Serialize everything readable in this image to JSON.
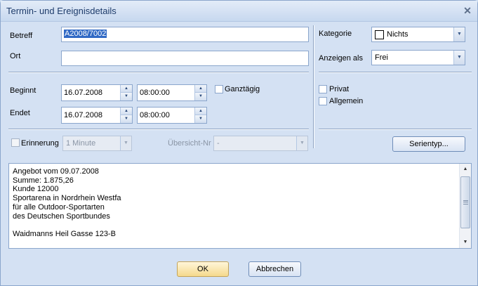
{
  "window": {
    "title": "Termin- und Ereignisdetails",
    "close_glyph": "✕"
  },
  "subject": {
    "label": "Betreff",
    "value": "A2008/7002"
  },
  "location": {
    "label": "Ort",
    "value": ""
  },
  "category": {
    "label": "Kategorie",
    "value": "Nichts"
  },
  "show_as": {
    "label": "Anzeigen als",
    "value": "Frei"
  },
  "start": {
    "label": "Beginnt",
    "date": "16.07.2008",
    "time": "08:00:00"
  },
  "end": {
    "label": "Endet",
    "date": "16.07.2008",
    "time": "08:00:00"
  },
  "all_day": {
    "label": "Ganztägig",
    "checked": false
  },
  "private": {
    "label": "Privat",
    "checked": false
  },
  "general": {
    "label": "Allgemein",
    "checked": false
  },
  "reminder": {
    "label": "Erinnerung",
    "checked": false,
    "value": "1 Minute"
  },
  "overview": {
    "label": "Übersicht-Nr",
    "value": "-"
  },
  "recurrence_button": "Serientyp...",
  "notes": "Angebot vom 09.07.2008\nSumme: 1.875,26\nKunde 12000\nSportarena in Nordrhein Westfa\nfür alle Outdoor-Sportarten\ndes Deutschen Sportbundes\n\nWaidmanns Heil Gasse 123-B",
  "buttons": {
    "ok": "OK",
    "cancel": "Abbrechen"
  },
  "icons": {
    "spin_up": "▲",
    "spin_down": "▼",
    "dropdown": "▼",
    "scroll_up": "▲",
    "scroll_down": "▼"
  }
}
